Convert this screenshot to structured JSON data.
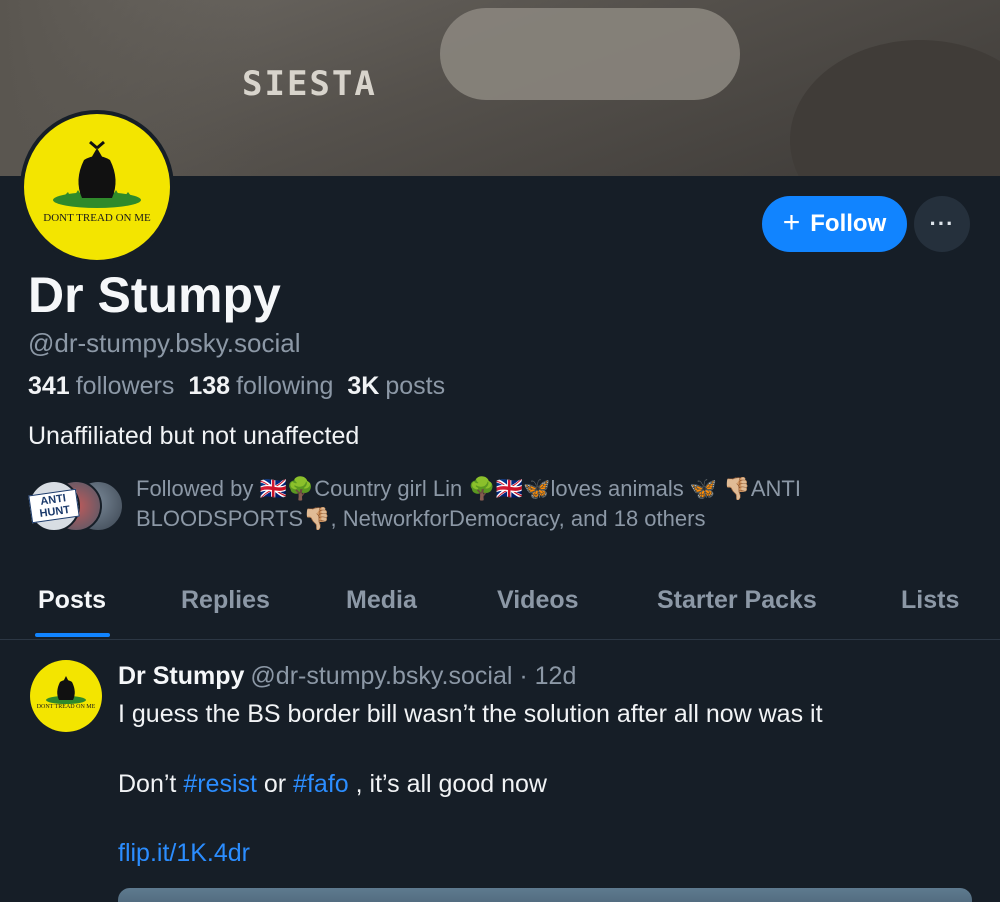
{
  "profile": {
    "banner_text": "SIESTA",
    "avatar_caption": "DONT TREAD ON ME",
    "display_name": "Dr Stumpy",
    "handle": "@dr-stumpy.bsky.social",
    "followers_count": "341",
    "followers_label": "followers",
    "following_count": "138",
    "following_label": "following",
    "posts_count": "3K",
    "posts_label": "posts",
    "bio": "Unaffiliated but not unaffected",
    "followed_by_text": "Followed by 🇬🇧🌳Country girl Lin 🌳🇬🇧🦋loves animals 🦋 👎🏼ANTI BLOODSPORTS👎🏼, NetworkforDemocracy, and 18 others",
    "followed_avatar_badge": "ANTI HUNT"
  },
  "actions": {
    "follow_icon": "+",
    "follow_label": "Follow",
    "more_label": "···"
  },
  "tabs": [
    {
      "label": "Posts",
      "active": true
    },
    {
      "label": "Replies",
      "active": false
    },
    {
      "label": "Media",
      "active": false
    },
    {
      "label": "Videos",
      "active": false
    },
    {
      "label": "Starter Packs",
      "active": false
    },
    {
      "label": "Lists",
      "active": false
    }
  ],
  "post": {
    "author": "Dr Stumpy",
    "handle": "@dr-stumpy.bsky.social",
    "time": "· 12d",
    "avatar_caption": "DONT TREAD ON ME",
    "line1": "I guess the BS border bill wasn’t the solution after all now was it",
    "line2_prefix": "Don’t ",
    "hashtag1": "#resist",
    "line2_mid": " or ",
    "hashtag2": "#fafo",
    "line2_suffix": " , it’s all good now",
    "link": "flip.it/1K.4dr"
  },
  "colors": {
    "background": "#161e27",
    "accent": "#1184ff",
    "muted_text": "#8c98a6",
    "avatar_yellow": "#f3e500"
  }
}
